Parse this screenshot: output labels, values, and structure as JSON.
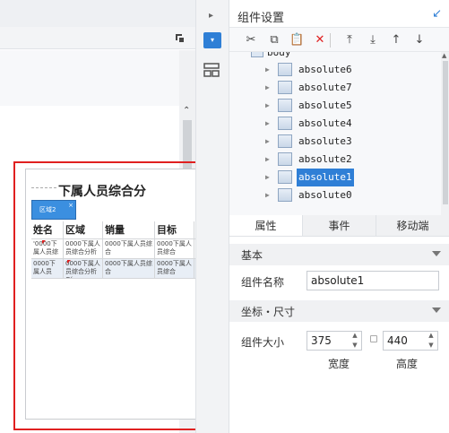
{
  "canvas": {
    "component_title": "下属人员综合分",
    "tab_label": "区域2",
    "move_glyph": "✥",
    "close_glyph": "×",
    "table": {
      "headers": [
        "姓名",
        "区域",
        "销量",
        "目标",
        ""
      ],
      "rows": [
        [
          "'0000下属人员综",
          "0000下属人员综合分析",
          "0000下属人员综合",
          "0000下属人员综合",
          ""
        ],
        [
          "0000下属人员",
          "0000下属人员综合分析G(",
          "0000下属人员综合",
          "0000下属人员综合",
          ""
        ]
      ]
    }
  },
  "strip": {
    "expand_glyph": "▸",
    "active_glyph": "▾"
  },
  "panel": {
    "title": "组件设置",
    "collapse_glyph": "↙",
    "toolbar": {
      "cut": "✂",
      "copy": "⧉",
      "paste": "📋",
      "delete": "✕",
      "to_top": "⤒",
      "to_bottom": "⤓",
      "move_up": "↑",
      "move_down": "↓"
    },
    "tree": {
      "root": "body",
      "expand_glyph": "▶",
      "items": [
        "absolute6",
        "absolute7",
        "absolute5",
        "absolute4",
        "absolute3",
        "absolute2",
        "absolute1",
        "absolute0"
      ],
      "selected": "absolute1"
    },
    "tabs": [
      "属性",
      "事件",
      "移动端"
    ],
    "sections": {
      "basic": "基本",
      "coords": "坐标・尺寸"
    },
    "fields": {
      "name_label": "组件名称",
      "name_value": "absolute1",
      "size_label": "组件大小",
      "width_value": "375",
      "height_value": "440",
      "width_caption": "宽度",
      "height_caption": "高度"
    }
  },
  "colors": {
    "accent": "#2f7fd6",
    "highlight": "#e02020"
  }
}
